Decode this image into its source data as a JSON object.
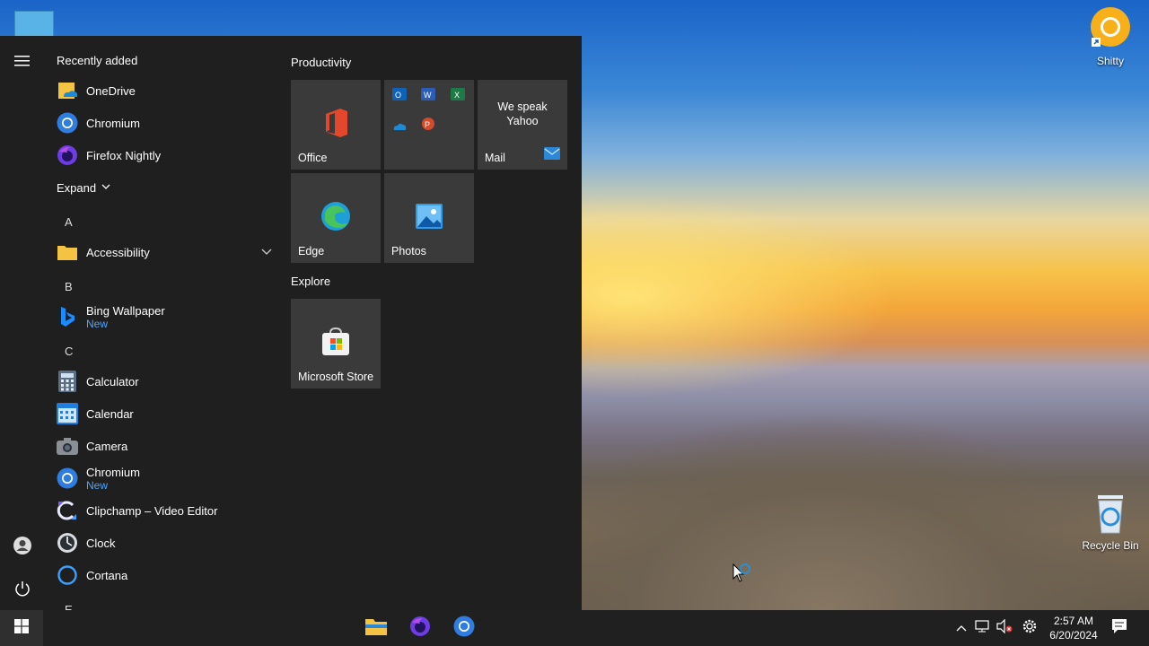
{
  "desktop": {
    "icons": [
      {
        "name": "Shitty",
        "icon": "chromium-canary-shortcut-icon"
      },
      {
        "name": "Recycle Bin",
        "icon": "recycle-bin-icon"
      }
    ]
  },
  "start_menu": {
    "recently_added_title": "Recently added",
    "recent": [
      {
        "label": "OneDrive",
        "icon": "onedrive-folder-icon"
      },
      {
        "label": "Chromium",
        "icon": "chromium-icon"
      },
      {
        "label": "Firefox Nightly",
        "icon": "firefox-nightly-icon"
      }
    ],
    "expand_label": "Expand",
    "sections": [
      {
        "letter": "A",
        "apps": [
          {
            "label": "Accessibility",
            "icon": "folder-icon"
          }
        ]
      },
      {
        "letter": "B",
        "apps": [
          {
            "label": "Bing Wallpaper",
            "sub": "New",
            "icon": "bing-icon"
          }
        ]
      },
      {
        "letter": "C",
        "apps": [
          {
            "label": "Calculator",
            "icon": "calculator-icon"
          },
          {
            "label": "Calendar",
            "icon": "calendar-icon"
          },
          {
            "label": "Camera",
            "icon": "camera-icon"
          },
          {
            "label": "Chromium",
            "sub": "New",
            "icon": "chromium-icon"
          },
          {
            "label": "Clipchamp – Video Editor",
            "icon": "clipchamp-icon"
          },
          {
            "label": "Clock",
            "icon": "clock-icon"
          },
          {
            "label": "Cortana",
            "icon": "cortana-icon"
          }
        ]
      },
      {
        "letter": "E",
        "apps": []
      }
    ],
    "groups": [
      {
        "title": "Productivity"
      },
      {
        "title": "Explore"
      }
    ],
    "tiles": [
      {
        "label": "Office",
        "icon": "office-icon"
      },
      {
        "label": "",
        "icon": "office-apps-cluster"
      },
      {
        "label": "Mail",
        "text": "We speak Yahoo",
        "icon": "mail-icon"
      },
      {
        "label": "Edge",
        "icon": "edge-icon"
      },
      {
        "label": "Photos",
        "icon": "photos-icon"
      },
      {
        "label": "Microsoft Store",
        "icon": "store-icon"
      }
    ]
  },
  "taskbar": {
    "pinned": [
      "file-explorer-icon",
      "firefox-nightly-icon",
      "chromium-icon"
    ],
    "clock": {
      "time": "2:57 AM",
      "date": "6/20/2024"
    }
  },
  "colors": {
    "start_bg": "#1f1f1f",
    "tile_bg": "#3a3a3a",
    "accent_new": "#4ea6ff",
    "taskbar_bg": "#202020"
  }
}
